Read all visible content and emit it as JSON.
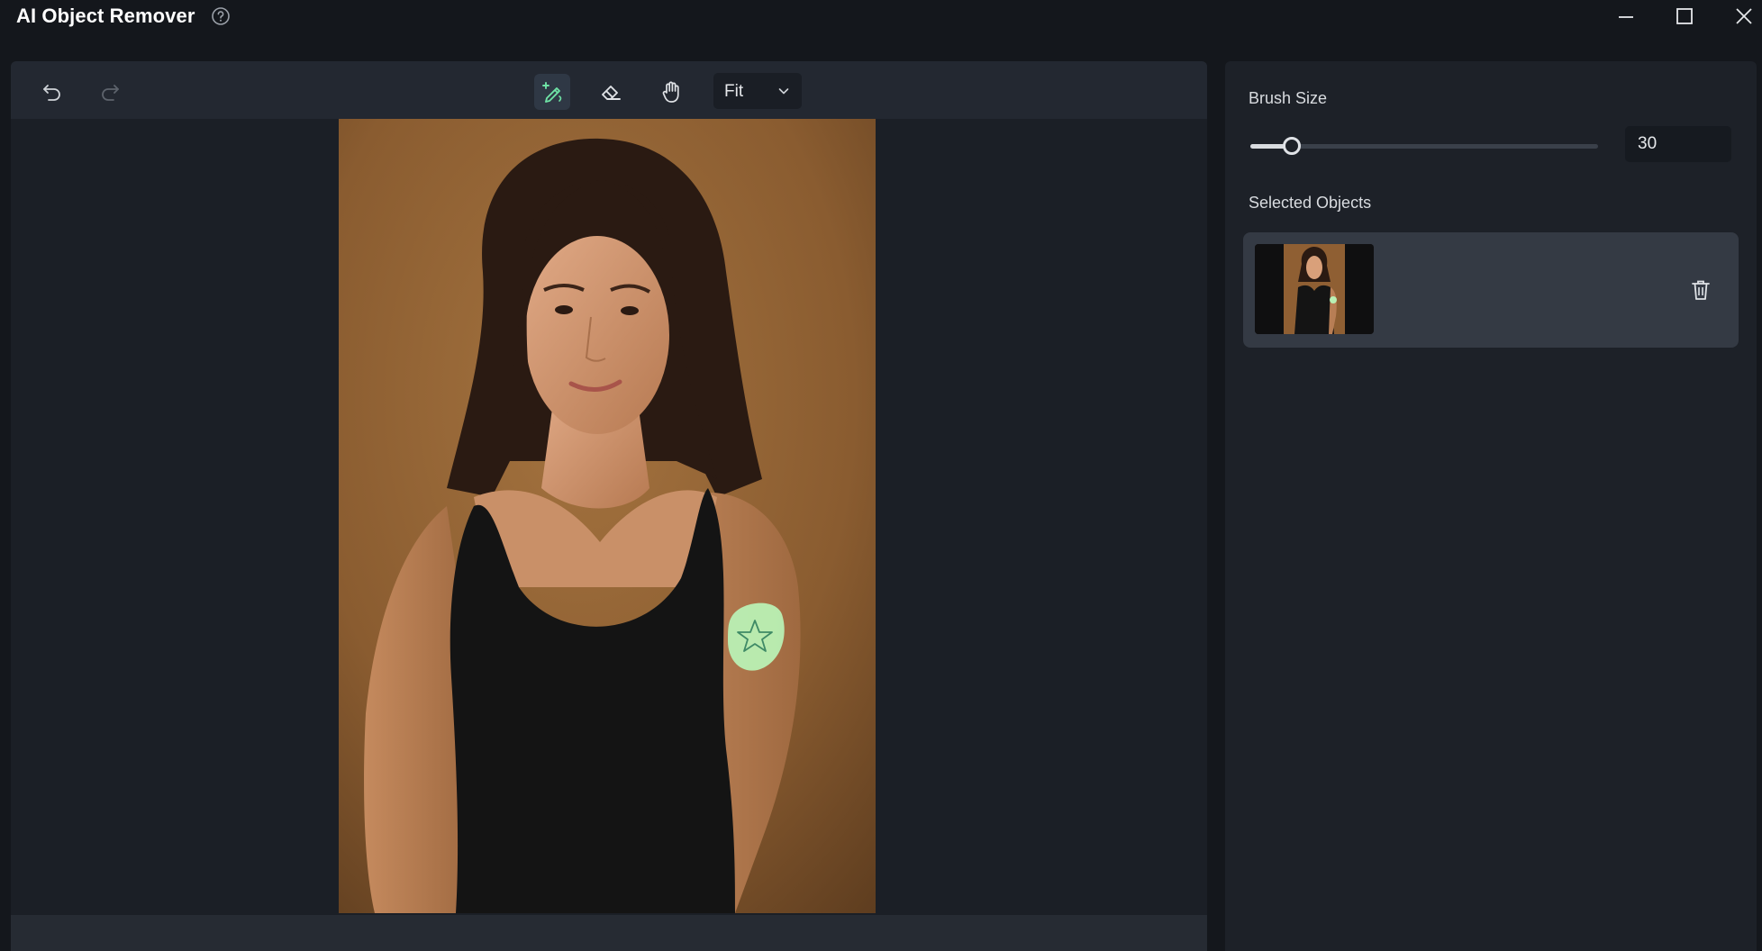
{
  "window": {
    "title": "AI Object Remover",
    "icons": [
      "help-circle-icon",
      "minimize-icon",
      "maximize-icon",
      "close-icon"
    ]
  },
  "toolbar": {
    "tools": [
      "undo-icon",
      "redo-icon",
      "brush-icon",
      "eraser-icon",
      "hand-icon"
    ],
    "active_tool": "brush",
    "zoom": {
      "selected": "Fit",
      "icon": "chevron-down-icon"
    }
  },
  "side_panel": {
    "brush_size": {
      "label": "Brush Size",
      "value": "30",
      "level": 0.12
    },
    "selected_objects": {
      "label": "Selected Objects",
      "items": [
        {
          "thumbnail": "portrait-thumbnail",
          "action_icon": "trash-icon"
        }
      ]
    }
  },
  "colors": {
    "background": "#14171c",
    "panel": "#1d2128",
    "toolbar": "#232831",
    "card": "#343a44",
    "accent": "#6fe3a6",
    "mask": "#b9f0b4"
  }
}
